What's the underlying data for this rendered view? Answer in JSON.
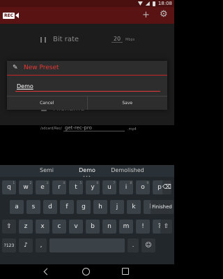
{
  "status_bar": {
    "time": "18:08"
  },
  "app_bar": {
    "logo_text": "REC"
  },
  "settings": {
    "bitrate_label": "Bit rate",
    "bitrate_value": "20",
    "bitrate_unit": "Mbps",
    "filename_label": "Filename",
    "path_prefix": "/sdcard/Rec/",
    "filename_value": "get-rec-pro",
    "extension": ".mp4"
  },
  "dialog": {
    "title": "New Preset",
    "input_value": "Demo",
    "cancel_label": "Cancel",
    "save_label": "Save"
  },
  "keyboard": {
    "suggestions": [
      "Semi",
      "Demo",
      "Demolished"
    ],
    "row1": [
      {
        "k": "q",
        "h": "1"
      },
      {
        "k": "w",
        "h": "2"
      },
      {
        "k": "e",
        "h": "3"
      },
      {
        "k": "r",
        "h": "4"
      },
      {
        "k": "t",
        "h": "5"
      },
      {
        "k": "y",
        "h": "6"
      },
      {
        "k": "u",
        "h": "7"
      },
      {
        "k": "i",
        "h": "8"
      },
      {
        "k": "o",
        "h": "9"
      },
      {
        "k": "p",
        "h": "0"
      }
    ],
    "row2": [
      "a",
      "s",
      "d",
      "f",
      "g",
      "h",
      "j",
      "k",
      "l"
    ],
    "row3": [
      "z",
      "x",
      "c",
      "v",
      "b",
      "n",
      "m",
      "!",
      "?"
    ],
    "finished_label": "Finished",
    "symbols_label": "?123",
    "comma_label": ",",
    "period_label": ".",
    "smiley_label": "☺"
  },
  "colors": {
    "accent": "#e53935",
    "appbar": "#5a1313"
  }
}
